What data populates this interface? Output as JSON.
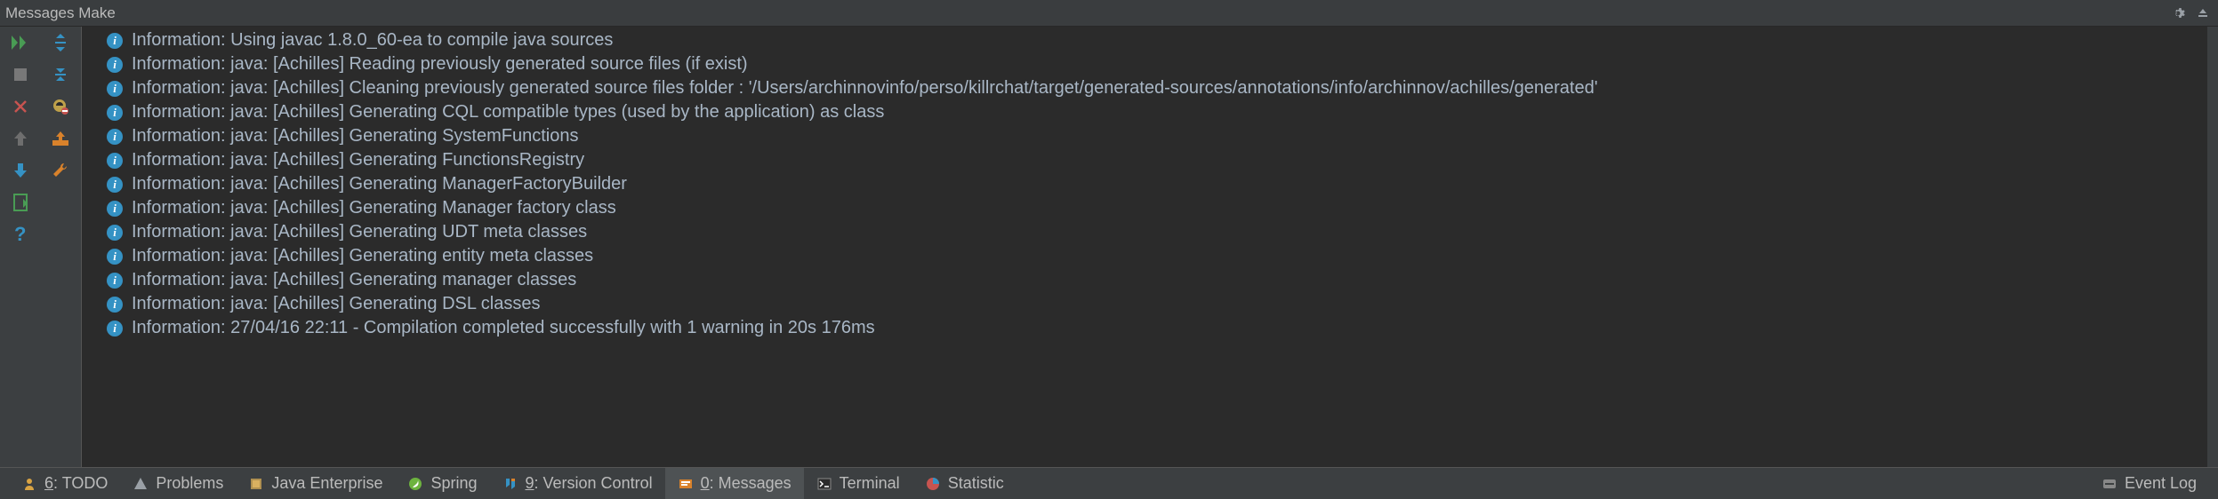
{
  "title_bar": {
    "title": "Messages Make"
  },
  "messages": [
    "Information: Using javac 1.8.0_60-ea to compile java sources",
    "Information: java: [Achilles] Reading previously generated source files (if exist)",
    "Information: java: [Achilles] Cleaning previously generated source files folder : '/Users/archinnovinfo/perso/killrchat/target/generated-sources/annotations/info/archinnov/achilles/generated'",
    "Information: java: [Achilles] Generating CQL compatible types (used by the application) as class",
    "Information: java: [Achilles] Generating SystemFunctions",
    "Information: java: [Achilles] Generating FunctionsRegistry",
    "Information: java: [Achilles] Generating ManagerFactoryBuilder",
    "Information: java: [Achilles] Generating Manager factory class",
    "Information: java: [Achilles] Generating UDT meta classes",
    "Information: java: [Achilles] Generating entity meta classes",
    "Information: java: [Achilles] Generating manager classes",
    "Information: java: [Achilles] Generating DSL classes",
    "Information: 27/04/16 22:11 - Compilation completed successfully with 1 warning in 20s 176ms"
  ],
  "bottom": {
    "todo": {
      "num": "6",
      "label": ": TODO"
    },
    "problems": "Problems",
    "java_ee": "Java Enterprise",
    "spring": "Spring",
    "vcs": {
      "num": "9",
      "label": ": Version Control"
    },
    "messages": {
      "num": "0",
      "label": ": Messages"
    },
    "terminal": "Terminal",
    "statistic": "Statistic",
    "event_log": "Event Log"
  }
}
